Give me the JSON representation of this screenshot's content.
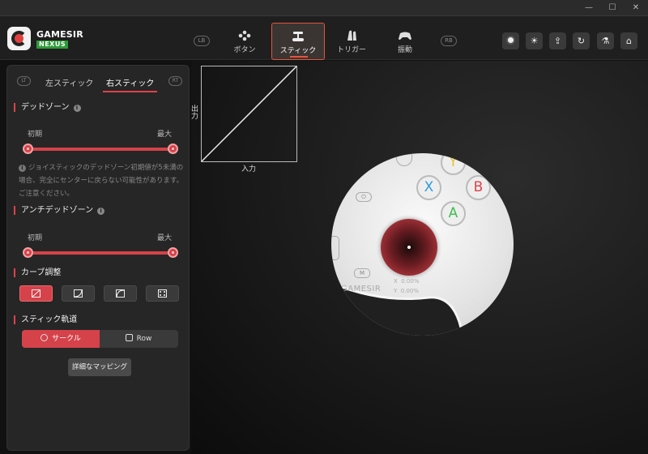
{
  "window": {
    "controls": [
      "—",
      "☐",
      "✕"
    ]
  },
  "brand": {
    "name": "GAMESIR",
    "sub": "NEXUS"
  },
  "nav": {
    "lb": "LB",
    "rb": "RB",
    "tabs": [
      {
        "label": "ボタン",
        "icon": "buttons-icon"
      },
      {
        "label": "スティック",
        "icon": "stick-icon",
        "active": true
      },
      {
        "label": "トリガー",
        "icon": "trigger-icon"
      },
      {
        "label": "振動",
        "icon": "vibration-icon"
      }
    ]
  },
  "toolbar": {
    "icons": [
      "record-icon",
      "brightness-icon",
      "upload-icon",
      "refresh-icon",
      "test-flask-icon",
      "home-icon"
    ]
  },
  "stick_panel": {
    "lt": "LT",
    "rt": "RT",
    "left_tab": "左スティック",
    "right_tab": "右スティック",
    "deadzone": {
      "title": "デッドゾーン",
      "min_label": "初期",
      "max_label": "最大",
      "note": "ジョイスティックのデッドゾーン初期値が5未満の場合、完全にセンターに戻らない可能性があります。ご注意ください。"
    },
    "anti_deadzone": {
      "title": "アンチデッドゾーン",
      "min_label": "初期",
      "max_label": "最大"
    },
    "curve": {
      "title": "カーブ調整"
    },
    "trajectory": {
      "title": "スティック軌道",
      "options": [
        "サークル",
        "Row"
      ],
      "selected": "サークル"
    },
    "advanced_button": "詳細なマッピング"
  },
  "graph": {
    "ylabel": "出力",
    "xlabel": "入力"
  },
  "controller_preview": {
    "buttons": {
      "x": "X",
      "a": "A",
      "b": "B",
      "y": "Y",
      "m": "M"
    },
    "brand": "GAMESIR",
    "readout": {
      "x_label": "X",
      "x_value": "0.00%",
      "y_label": "Y",
      "y_value": "0.00%"
    },
    "colors": {
      "x": "#2e9be0",
      "a": "#3fbe4a",
      "b": "#e0414a",
      "y": "#e8c230",
      "stick": "#d5424a"
    }
  }
}
